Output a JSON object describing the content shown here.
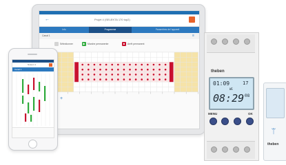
{
  "tablet": {
    "title": "Projet 4 (SELEKTA 170 top2)",
    "tabs": [
      "Info",
      "Programme",
      "Paramètres de l'appareil"
    ],
    "active_tab": 1,
    "section_label": "Canal 1",
    "legend": [
      {
        "label": "Sélectionner",
        "color": "#cccccc"
      },
      {
        "label": "Marche permanente",
        "color": "#2eaa3c"
      },
      {
        "label": "Arrêt permanent",
        "color": "#c8102e"
      }
    ],
    "add_label": "+"
  },
  "phone": {
    "title": "Noteon 1",
    "tab": "Canal 1"
  },
  "timer": {
    "brand": "theben",
    "time_small": "01:09",
    "day": "17",
    "weekday": "WE",
    "time_big": "08:29",
    "seconds": "08",
    "buttons": [
      "MENU",
      "OK"
    ]
  },
  "dongle": {
    "brand": "theben"
  },
  "colors": {
    "accent": "#2c79bf",
    "accent_dark": "#1c4f86",
    "on": "#2eaa3c",
    "off": "#c8102e",
    "orange": "#e8632b",
    "lcd": "#cfe6f3"
  }
}
